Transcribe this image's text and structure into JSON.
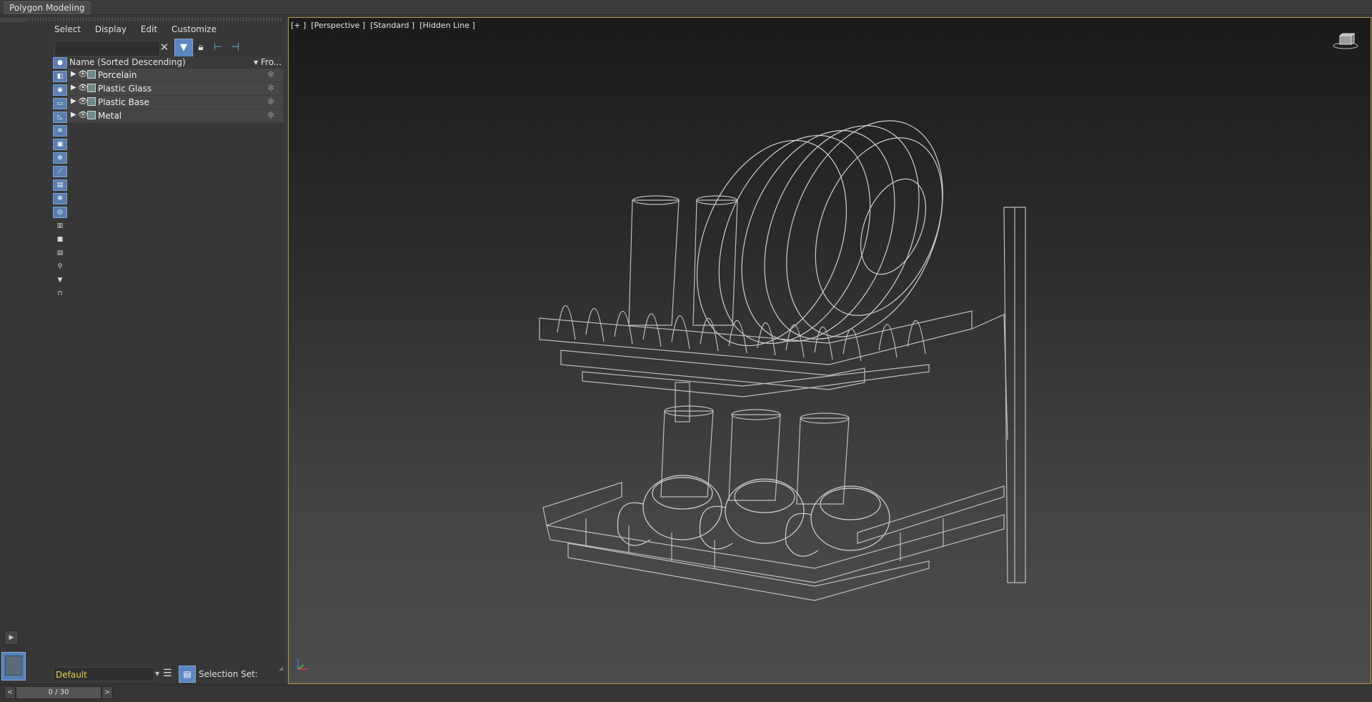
{
  "ribbon": {
    "tab_label": "Polygon Modeling"
  },
  "explorer": {
    "menu": [
      "Select",
      "Display",
      "Edit",
      "Customize"
    ],
    "search": {
      "value": "",
      "placeholder": ""
    },
    "columns": {
      "name": "Name (Sorted Descending)",
      "frozen": "Fro..."
    },
    "rows": [
      {
        "name": "Porcelain"
      },
      {
        "name": "Plastic Glass"
      },
      {
        "name": "Plastic Base"
      },
      {
        "name": "Metal"
      }
    ],
    "layer_dropdown": "Default",
    "selection_set_label": "Selection Set:"
  },
  "viewport": {
    "label_plus": "[+ ]",
    "label_view": "[Perspective ]",
    "label_shading_std": "[Standard ]",
    "label_shading_mode": "[Hidden Line ]"
  },
  "timeline": {
    "frame_text": "0 / 30",
    "prev": "<",
    "next": ">"
  },
  "colors": {
    "accent": "#5b86c0",
    "viewport_border": "#b29c45",
    "layer_text": "#e8d14a"
  }
}
